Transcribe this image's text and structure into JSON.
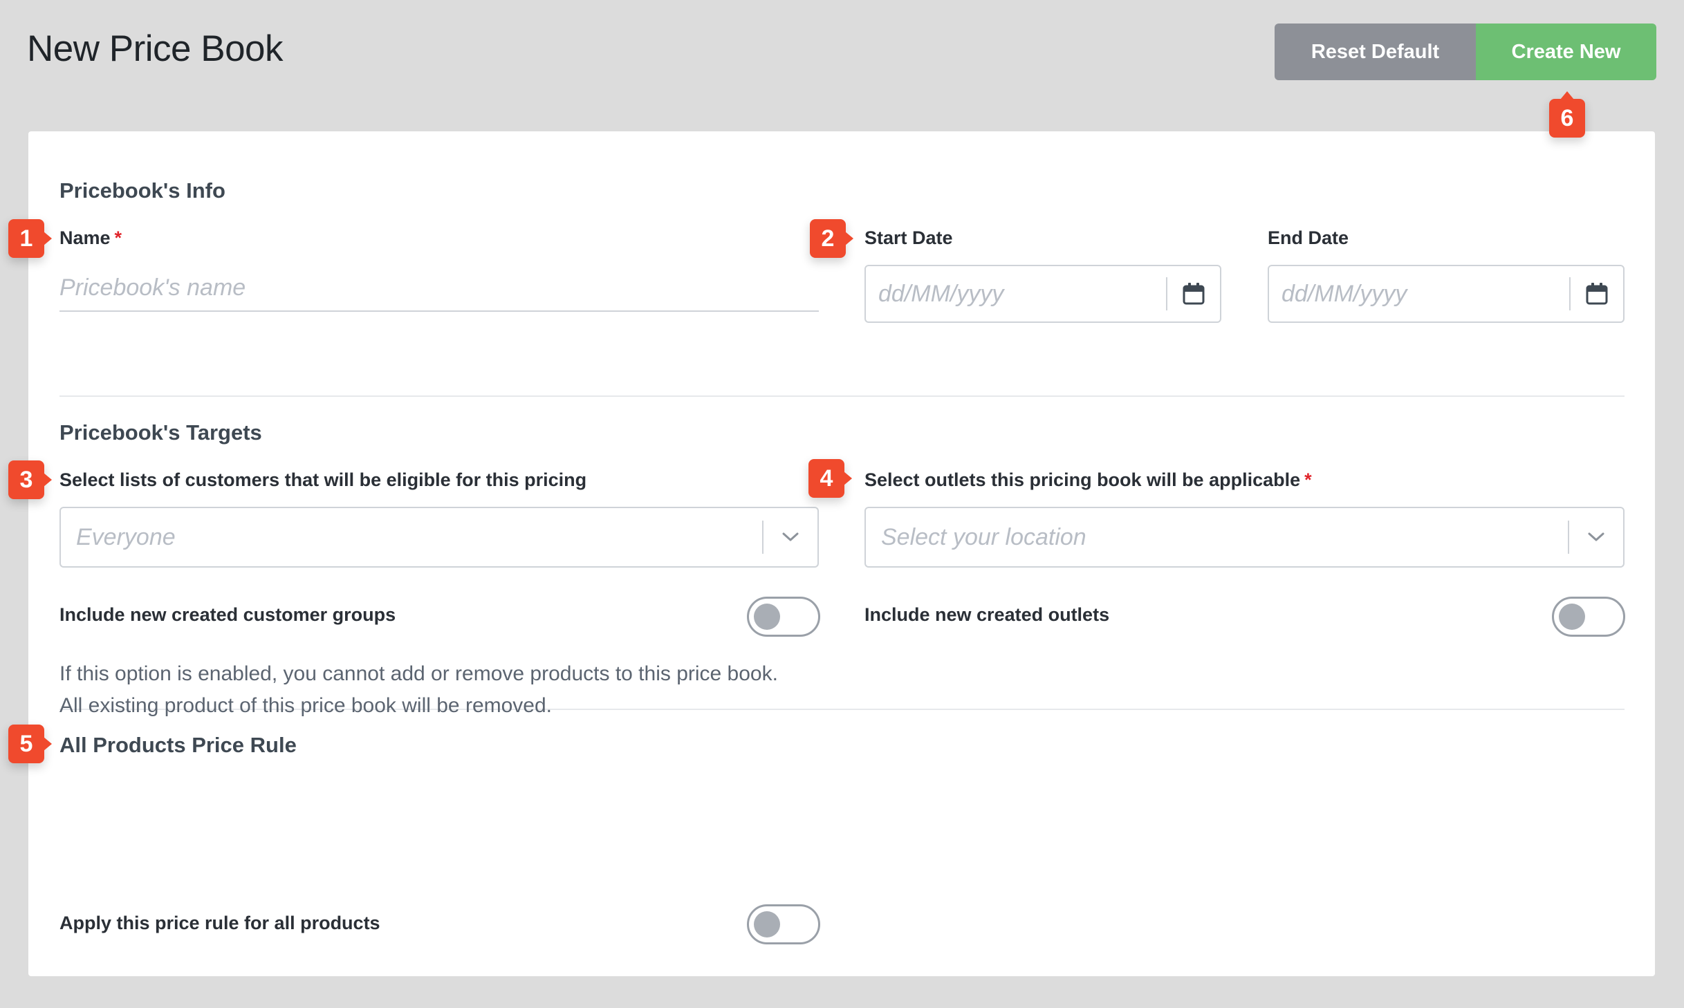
{
  "header": {
    "title": "New Price Book",
    "reset_label": "Reset Default",
    "create_label": "Create New"
  },
  "info": {
    "section_title": "Pricebook's Info",
    "name_label": "Name",
    "required_mark": "*",
    "name_placeholder": "Pricebook's name",
    "start_date_label": "Start Date",
    "start_date_placeholder": "dd/MM/yyyy",
    "end_date_label": "End Date",
    "end_date_placeholder": "dd/MM/yyyy"
  },
  "targets": {
    "section_title": "Pricebook's Targets",
    "customers_label": "Select lists of customers that will be eligible for this pricing",
    "customers_placeholder": "Everyone",
    "outlets_label": "Select outlets this pricing book will be applicable",
    "outlets_placeholder": "Select your location",
    "include_groups_label": "Include new created customer groups",
    "include_outlets_label": "Include new created outlets"
  },
  "rule": {
    "section_title": "All Products Price Rule",
    "desc_line1": "If this option is enabled, you cannot add or remove products to this price book.",
    "desc_line2": "All existing product of this price book will be removed.",
    "apply_label": "Apply this price rule for all products"
  },
  "toggles": {
    "include_groups": false,
    "include_outlets": false,
    "apply_all": false
  },
  "badges": [
    "1",
    "2",
    "3",
    "4",
    "5",
    "6"
  ],
  "colors": {
    "background": "#dcdcdc",
    "reset_button": "#8d9097",
    "create_button": "#6dbf73",
    "badge": "#f04a2d",
    "required": "#e0252b"
  },
  "icons": {
    "date_picker": "calendar-icon",
    "dropdown": "chevron-down-icon"
  }
}
